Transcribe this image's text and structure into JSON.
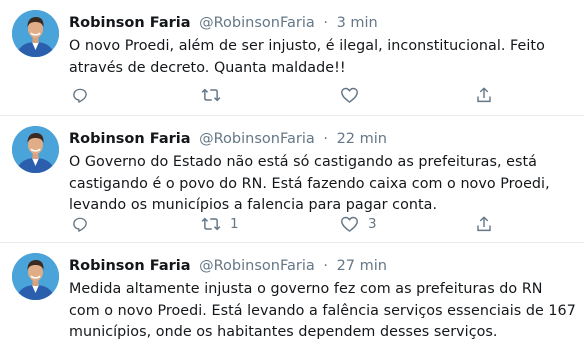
{
  "tweets": [
    {
      "name": "Robinson Faria",
      "handle": "@RobinsonFaria",
      "separator": "·",
      "time": "3 min",
      "text": "O novo Proedi, além de ser injusto, é ilegal, inconstitucional. Feito através de decreto. Quanta maldade!!",
      "retweets": "",
      "likes": ""
    },
    {
      "name": "Robinson Faria",
      "handle": "@RobinsonFaria",
      "separator": "·",
      "time": "22 min",
      "text": "O Governo do Estado não está só castigando as prefeituras, está castigando é o povo do RN. Está fazendo caixa com o novo Proedi, levando os municípios a falencia para pagar conta.",
      "retweets": "1",
      "likes": "3"
    },
    {
      "name": "Robinson Faria",
      "handle": "@RobinsonFaria",
      "separator": "·",
      "time": "27 min",
      "text": "Medida altamente injusta o governo fez com as prefeituras do RN com o novo Proedi. Está levando a falência serviços essenciais de 167 municípios, onde os habitantes dependem desses serviços."
    }
  ],
  "icons": {
    "reply": "reply-icon",
    "retweet": "retweet-icon",
    "like": "heart-icon",
    "share": "share-icon"
  },
  "colors": {
    "text": "#14171a",
    "secondary": "#657786",
    "divider": "#e6ecf0",
    "avatar_bg": "#4aa3d9"
  }
}
